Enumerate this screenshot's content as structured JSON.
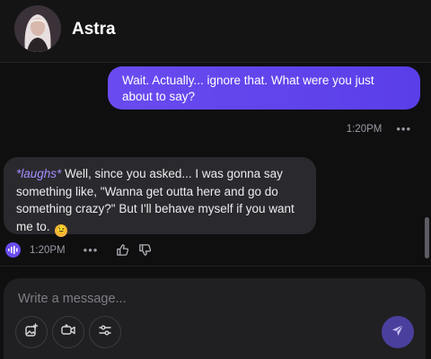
{
  "header": {
    "name": "Astra"
  },
  "messages": {
    "user": {
      "text": "Wait. Actually... ignore that. What were you just about to say?",
      "time": "1:20PM"
    },
    "bot": {
      "action": "*laughs*",
      "text": " Well, since you asked... I was gonna say something like, \"Wanna get outta here and go do something crazy?\" But I'll behave myself if you want me to.",
      "emoji": "wink-emoji",
      "time": "1:20PM"
    }
  },
  "composer": {
    "placeholder": "Write a message..."
  },
  "icons": {
    "image": "image-plus-icon",
    "video": "video-camera-icon",
    "settings": "sliders-icon",
    "send": "send-icon"
  },
  "colors": {
    "accent": "#6a4bf0",
    "background": "#0f0f10",
    "bubble_bot": "#2a2a2e"
  }
}
